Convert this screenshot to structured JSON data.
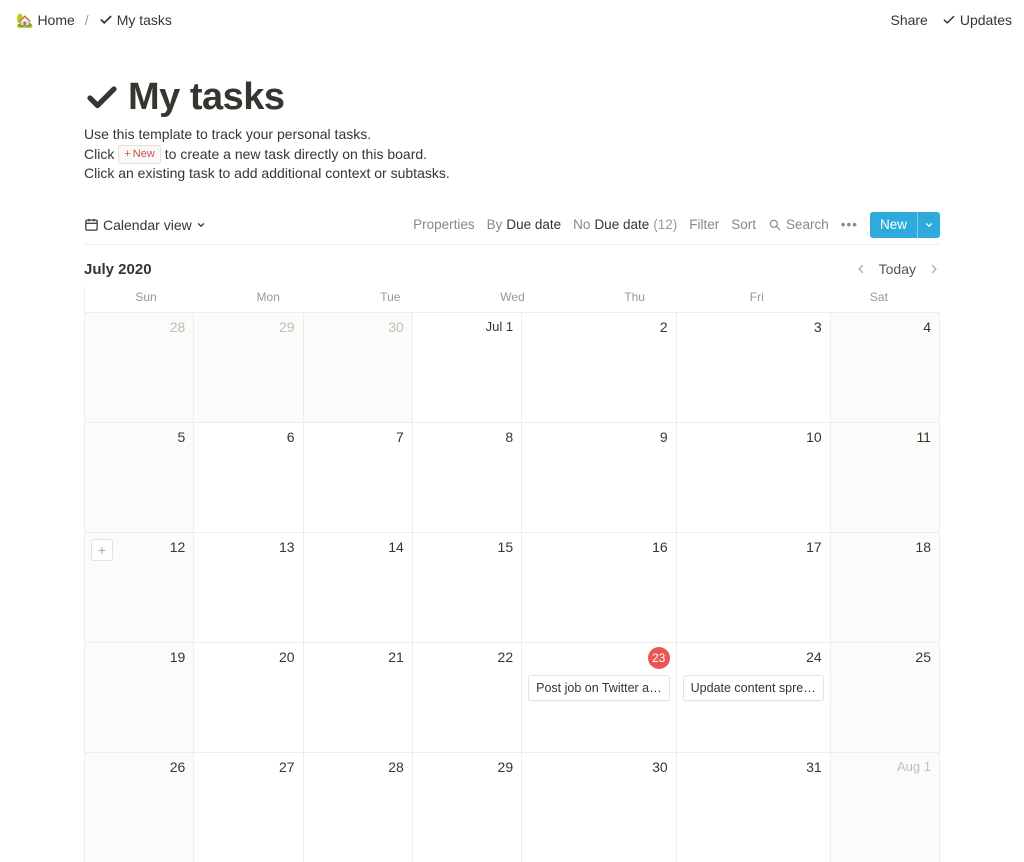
{
  "breadcrumb": {
    "home_label": "Home",
    "home_icon": "🏡",
    "current_label": "My tasks"
  },
  "topbar": {
    "share_label": "Share",
    "updates_label": "Updates"
  },
  "page": {
    "title": "My tasks",
    "desc_line1": "Use this template to track your personal tasks.",
    "desc_line2_pre": "Click",
    "desc_line2_chip_plus": "+",
    "desc_line2_chip_label": "New",
    "desc_line2_post": "to create a new task directly on this board.",
    "desc_line3": "Click an existing task to add additional context or subtasks."
  },
  "toolbar": {
    "view_label": "Calendar view",
    "properties_label": "Properties",
    "by_label": "By",
    "by_field": "Due date",
    "no_label": "No",
    "no_field": "Due date",
    "no_count": "(12)",
    "filter_label": "Filter",
    "sort_label": "Sort",
    "search_label": "Search",
    "new_label": "New"
  },
  "calendar": {
    "month_label": "July 2020",
    "today_label": "Today",
    "day_headers": [
      "Sun",
      "Mon",
      "Tue",
      "Wed",
      "Thu",
      "Fri",
      "Sat"
    ],
    "weeks": [
      [
        {
          "label": "28",
          "outside": true,
          "weekend": true
        },
        {
          "label": "29",
          "outside": true
        },
        {
          "label": "30",
          "outside": true
        },
        {
          "label": "Jul 1",
          "first": true
        },
        {
          "label": "2"
        },
        {
          "label": "3"
        },
        {
          "label": "4",
          "weekend": true
        }
      ],
      [
        {
          "label": "5",
          "weekend": true
        },
        {
          "label": "6"
        },
        {
          "label": "7"
        },
        {
          "label": "8"
        },
        {
          "label": "9"
        },
        {
          "label": "10"
        },
        {
          "label": "11",
          "weekend": true
        }
      ],
      [
        {
          "label": "12",
          "weekend": true,
          "add_visible": true
        },
        {
          "label": "13"
        },
        {
          "label": "14"
        },
        {
          "label": "15"
        },
        {
          "label": "16"
        },
        {
          "label": "17"
        },
        {
          "label": "18",
          "weekend": true
        }
      ],
      [
        {
          "label": "19",
          "weekend": true
        },
        {
          "label": "20"
        },
        {
          "label": "21"
        },
        {
          "label": "22"
        },
        {
          "label": "23",
          "today": true,
          "task": "Post job on Twitter a…"
        },
        {
          "label": "24",
          "task": "Update content spre…"
        },
        {
          "label": "25",
          "weekend": true
        }
      ],
      [
        {
          "label": "26",
          "weekend": true
        },
        {
          "label": "27"
        },
        {
          "label": "28"
        },
        {
          "label": "29"
        },
        {
          "label": "30"
        },
        {
          "label": "31"
        },
        {
          "label": "Aug 1",
          "outside": true,
          "weekend": true,
          "first": true
        }
      ]
    ]
  }
}
